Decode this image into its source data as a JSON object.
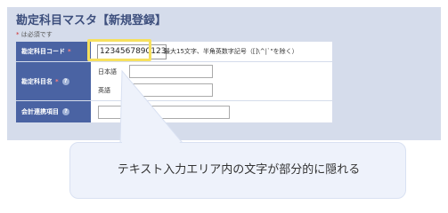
{
  "page": {
    "title": "勘定科目マスタ【新規登録】",
    "required_note": "は必須です",
    "required_mark": "*"
  },
  "form": {
    "code": {
      "label": "勘定科目コード",
      "value": "12345678901234",
      "hint": "最大15文字、半角英数字記号（[]\\^|`\"を除く）"
    },
    "name": {
      "label": "勘定科目名",
      "help": "?",
      "japanese_label": "日本語",
      "english_label": "英語",
      "japanese_value": "",
      "english_value": ""
    },
    "account_link": {
      "label": "会計連携項目",
      "help": "?",
      "value": ""
    }
  },
  "callout": {
    "text": "テキスト入力エリア内の文字が部分的に隠れる"
  },
  "colors": {
    "label_bg": "#4a63a3",
    "panel_bg": "#d5dceb",
    "highlight": "#f6e05e",
    "callout_bg": "#eef2fb"
  }
}
